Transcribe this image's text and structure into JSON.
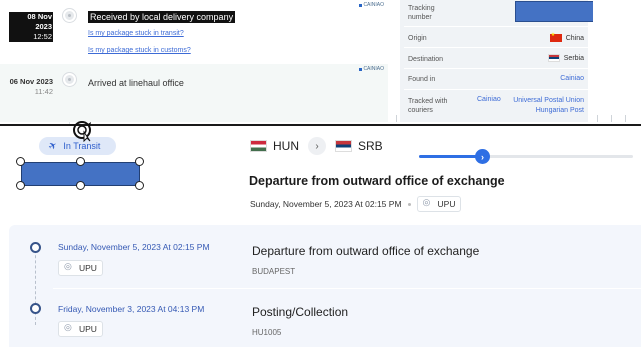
{
  "top_events": [
    {
      "date": "08 Nov 2023",
      "time": "12:52",
      "title": "Received by local delivery company",
      "source": "CAINIAO",
      "links": [
        "Is my package stuck in transit?",
        "Is my package stuck in customs?"
      ]
    },
    {
      "date": "06 Nov 2023",
      "time": "11:42",
      "title": "Arrived at linehaul office",
      "source": "CAINIAO"
    }
  ],
  "info_panel": {
    "tracking_number_label": "Tracking number",
    "origin_label": "Origin",
    "origin_value": "China",
    "destination_label": "Destination",
    "destination_value": "Serbia",
    "found_in_label": "Found in",
    "found_in_value": "Cainiao",
    "tracked_with_label": "Tracked with couriers",
    "tracked_with_values": [
      "Cainiao",
      "Universal Postal Union",
      "Hungarian Post"
    ]
  },
  "status": {
    "badge": "In Transit",
    "from_code": "HUN",
    "to_code": "SRB",
    "progress_fraction": 0.3,
    "progress_icon": "chevron-right",
    "title": "Departure from outward office of exchange",
    "datetime": "Sunday, November 5, 2023 At 02:15 PM",
    "carrier": "UPU"
  },
  "history": [
    {
      "date": "Sunday, November 5, 2023 At 02:15 PM",
      "carrier": "UPU",
      "title": "Departure from outward office of exchange",
      "location": "BUDAPEST"
    },
    {
      "date": "Friday, November 3, 2023 At 04:13 PM",
      "carrier": "UPU",
      "title": "Posting/Collection",
      "location": "HU1005"
    }
  ],
  "colors": {
    "accent": "#2f6fe4",
    "redaction": "#4472c4",
    "link": "#3d6bd6"
  },
  "icons": [
    "plane-icon",
    "refresh-cursor-icon",
    "chevron-right-icon",
    "upu-logo-icon",
    "flag-cn-icon",
    "flag-rs-icon",
    "flag-hu-icon"
  ]
}
